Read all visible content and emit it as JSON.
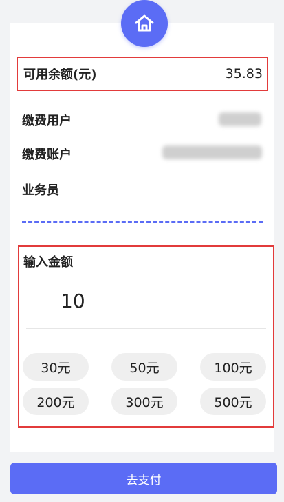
{
  "header": {
    "icon": "home-icon",
    "accent_color": "#5b6cf5"
  },
  "balance": {
    "label": "可用余额(元)",
    "value": "35.83"
  },
  "info": {
    "payer_label": "缴费用户",
    "account_label": "缴费账户",
    "agent_label": "业务员"
  },
  "amount": {
    "title": "输入金额",
    "value": "10",
    "presets": [
      "30元",
      "50元",
      "100元",
      "200元",
      "300元",
      "500元"
    ]
  },
  "pay_button": {
    "label": "去支付"
  },
  "highlight_color": "#e23b3b"
}
